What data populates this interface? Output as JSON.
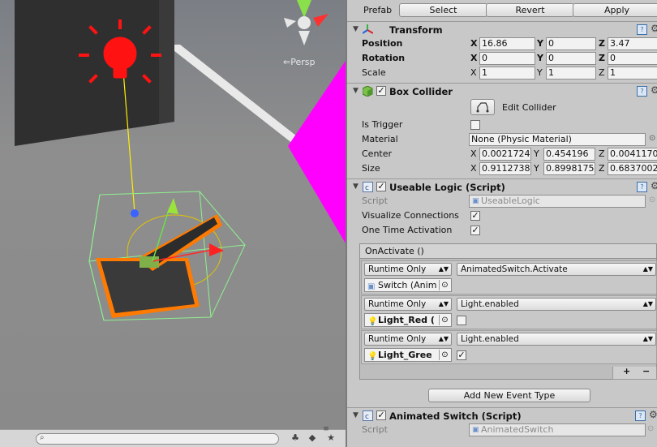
{
  "scene": {
    "persp_label": "Persp",
    "search_placeholder": "",
    "icons": [
      "search-icon",
      "layers-icon",
      "tag-icon",
      "star-icon",
      "lock-icon",
      "menu-icon"
    ]
  },
  "prefab": {
    "label": "Prefab",
    "select": "Select",
    "revert": "Revert",
    "apply": "Apply"
  },
  "transform": {
    "title": "Transform",
    "position_label": "Position",
    "rotation_label": "Rotation",
    "scale_label": "Scale",
    "position": {
      "x": "16.86",
      "y": "0",
      "z": "3.47"
    },
    "rotation": {
      "x": "0",
      "y": "0",
      "z": "0"
    },
    "scale": {
      "x": "1",
      "y": "1",
      "z": "1"
    }
  },
  "axes": {
    "x": "X",
    "y": "Y",
    "z": "Z"
  },
  "box_collider": {
    "title": "Box Collider",
    "edit_collider": "Edit Collider",
    "is_trigger_label": "Is Trigger",
    "material_label": "Material",
    "material_value": "None (Physic Material)",
    "center_label": "Center",
    "center": {
      "x": "0.0021724",
      "y": "0.454196",
      "z": "0.0041170"
    },
    "size_label": "Size",
    "size": {
      "x": "0.9112738",
      "y": "0.8998175",
      "z": "0.6837002"
    }
  },
  "useable_logic": {
    "title": "Useable Logic (Script)",
    "script_label": "Script",
    "script_value": "UseableLogic",
    "visualize_label": "Visualize Connections",
    "one_time_label": "One Time Activation",
    "event_title": "OnActivate ()",
    "entries": [
      {
        "mode": "Runtime Only",
        "function": "AnimatedSwitch.Activate",
        "object": "Switch (Anim"
      },
      {
        "mode": "Runtime Only",
        "function": "Light.enabled",
        "object": "Light_Red ("
      },
      {
        "mode": "Runtime Only",
        "function": "Light.enabled",
        "object": "Light_Gree"
      }
    ],
    "plus": "+",
    "minus": "−",
    "add_event": "Add New Event Type"
  },
  "animated_switch": {
    "title": "Animated Switch (Script)",
    "script_label": "Script",
    "script_value": "AnimatedSwitch"
  },
  "colors": {
    "light_icon_red": "#ff1a1a",
    "magenta": "#ff00ff",
    "selection_orange": "#ff7a00",
    "bounds_green": "#90ee90"
  }
}
